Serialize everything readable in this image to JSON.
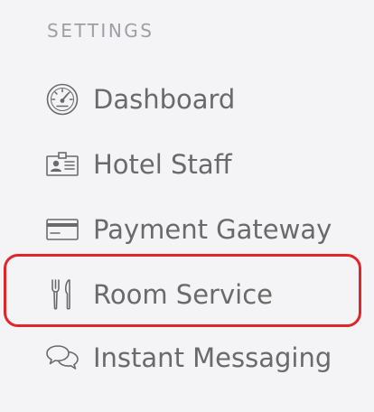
{
  "sidebar": {
    "section_title": "SETTINGS",
    "items": [
      {
        "label": "Dashboard",
        "icon": "dashboard-gauge-icon"
      },
      {
        "label": "Hotel Staff",
        "icon": "id-badge-icon"
      },
      {
        "label": "Payment Gateway",
        "icon": "credit-card-icon"
      },
      {
        "label": "Room Service",
        "icon": "fork-knife-icon"
      },
      {
        "label": "Instant Messaging",
        "icon": "chat-bubbles-icon"
      }
    ]
  },
  "colors": {
    "background": "#f4f4f6",
    "text": "#6a6a6a",
    "section_title": "#9e9ea4",
    "highlight": "#e0252b"
  }
}
